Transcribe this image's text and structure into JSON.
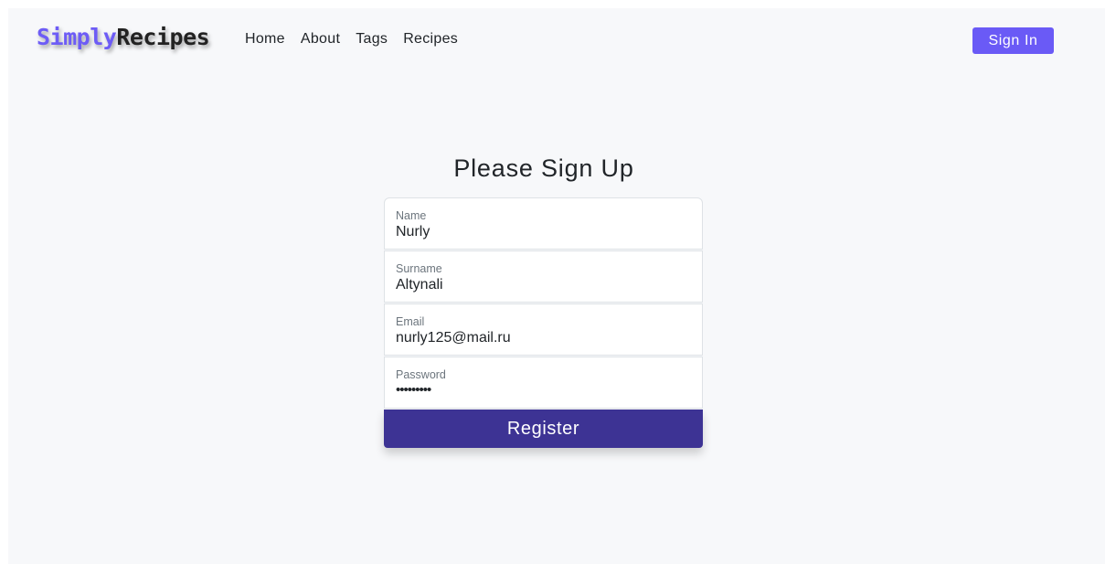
{
  "brand": {
    "part1": "Simply",
    "part2": "Recipes"
  },
  "nav": {
    "links": [
      "Home",
      "About",
      "Tags",
      "Recipes"
    ],
    "signin_label": "Sign In"
  },
  "form": {
    "title": "Please Sign Up",
    "fields": [
      {
        "label": "Name",
        "value": "Nurly"
      },
      {
        "label": "Surname",
        "value": "Altynali"
      },
      {
        "label": "Email",
        "value": "nurly125@mail.ru"
      },
      {
        "label": "Password",
        "value": "•••••••••"
      }
    ],
    "submit_label": "Register"
  },
  "colors": {
    "brand_accent": "#6d5cf6",
    "signin_button": "#6a5af6",
    "register_button": "#3d3394",
    "page_background": "#f7f8fa"
  }
}
